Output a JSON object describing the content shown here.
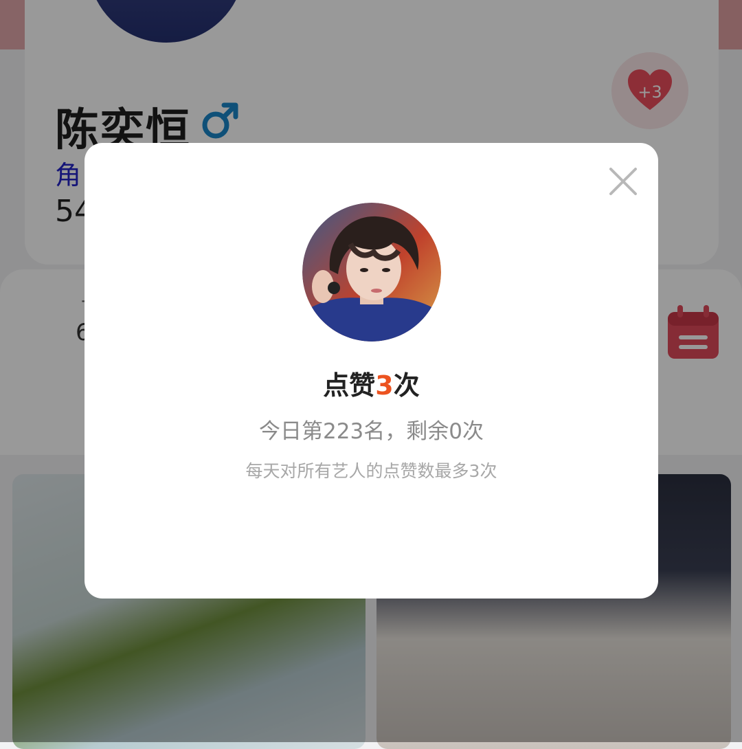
{
  "profile": {
    "name": "陈奕恒",
    "gender_symbol": "♂",
    "role_fragment": "角",
    "stat_fragment": "54"
  },
  "like_badge": {
    "count_label": "+3",
    "icon": "heart-icon",
    "color": "#ec4d5c"
  },
  "second_card": {
    "fragment_top": "-",
    "fragment_value": "6"
  },
  "modal": {
    "title_prefix": "点赞",
    "title_count": "3",
    "title_suffix": "次",
    "rank_text": "今日第223名，剩余0次",
    "note_text": "每天对所有艺人的点赞数最多3次",
    "close_icon": "close-icon"
  },
  "colors": {
    "accent": "#ec5320",
    "role_link": "#2424c8",
    "gender": "#1a86c8",
    "calendar": "#e04a5a"
  }
}
